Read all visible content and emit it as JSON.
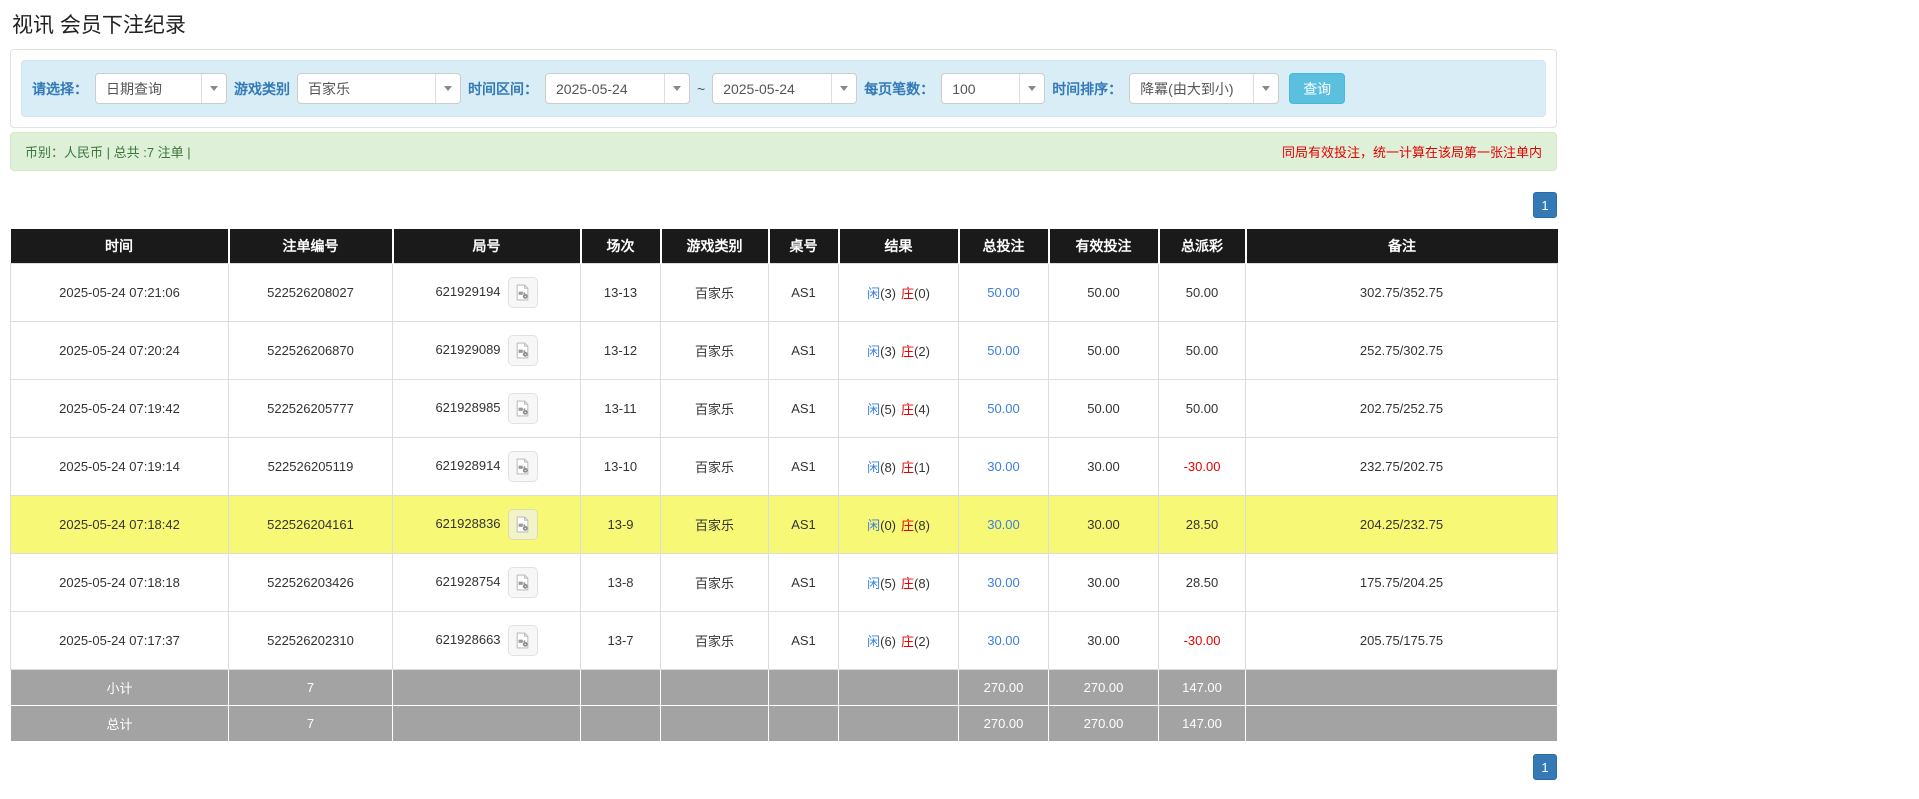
{
  "page": {
    "title": "视讯 会员下注纪录"
  },
  "filter": {
    "select_label": "请选择：",
    "select_value": "日期查询",
    "game_label": "游戏类别",
    "game_value": "百家乐",
    "range_label": "时间区间：",
    "date_from": "2025-05-24",
    "range_sep": "~",
    "date_to": "2025-05-24",
    "pagesize_label": "每页笔数：",
    "pagesize_value": "100",
    "sort_label": "时间排序：",
    "sort_value": "降冪(由大到小)",
    "search_label": "查询"
  },
  "summary": {
    "currency_info": "币别：人民币 | 总共 :7 注单 |",
    "note": "同局有效投注，统一计算在该局第一张注单内"
  },
  "pagination": {
    "page": "1"
  },
  "icons": {
    "row_action": "video-replay-icon",
    "dropdown": "chevron-down-icon"
  },
  "colors": {
    "label_blue": "#337ab7",
    "link_blue": "#3a7fe0",
    "negative_red": "#e60000",
    "highlight_yellow": "#f8f877",
    "header_bg": "#1a1a1a",
    "footer_gray": "#a3a3a3",
    "info_green": "#3c763d",
    "search_button_bg": "#5bc0de",
    "filter_bar_bg": "#d9edf7",
    "summary_bar_bg": "#dff0d8"
  },
  "table": {
    "headers": [
      "时间",
      "注单编号",
      "局号",
      "场次",
      "游戏类别",
      "桌号",
      "结果",
      "总投注",
      "有效投注",
      "总派彩",
      "备注"
    ],
    "rows": [
      {
        "time": "2025-05-24 07:21:06",
        "bet_no": "522526208027",
        "round_no": "621929194",
        "session": "13-13",
        "game": "百家乐",
        "table_no": "AS1",
        "player_label": "闲",
        "player_count": "(3)",
        "banker_label": "庄",
        "banker_count": "(0)",
        "total_bet": "50.00",
        "valid_bet": "50.00",
        "payout": "50.00",
        "payout_neg": false,
        "remark": "302.75/352.75",
        "highlight": false
      },
      {
        "time": "2025-05-24 07:20:24",
        "bet_no": "522526206870",
        "round_no": "621929089",
        "session": "13-12",
        "game": "百家乐",
        "table_no": "AS1",
        "player_label": "闲",
        "player_count": "(3)",
        "banker_label": "庄",
        "banker_count": "(2)",
        "total_bet": "50.00",
        "valid_bet": "50.00",
        "payout": "50.00",
        "payout_neg": false,
        "remark": "252.75/302.75",
        "highlight": false
      },
      {
        "time": "2025-05-24 07:19:42",
        "bet_no": "522526205777",
        "round_no": "621928985",
        "session": "13-11",
        "game": "百家乐",
        "table_no": "AS1",
        "player_label": "闲",
        "player_count": "(5)",
        "banker_label": "庄",
        "banker_count": "(4)",
        "total_bet": "50.00",
        "valid_bet": "50.00",
        "payout": "50.00",
        "payout_neg": false,
        "remark": "202.75/252.75",
        "highlight": false
      },
      {
        "time": "2025-05-24 07:19:14",
        "bet_no": "522526205119",
        "round_no": "621928914",
        "session": "13-10",
        "game": "百家乐",
        "table_no": "AS1",
        "player_label": "闲",
        "player_count": "(8)",
        "banker_label": "庄",
        "banker_count": "(1)",
        "total_bet": "30.00",
        "valid_bet": "30.00",
        "payout": "-30.00",
        "payout_neg": true,
        "remark": "232.75/202.75",
        "highlight": false
      },
      {
        "time": "2025-05-24 07:18:42",
        "bet_no": "522526204161",
        "round_no": "621928836",
        "session": "13-9",
        "game": "百家乐",
        "table_no": "AS1",
        "player_label": "闲",
        "player_count": "(0)",
        "banker_label": "庄",
        "banker_count": "(8)",
        "total_bet": "30.00",
        "valid_bet": "30.00",
        "payout": "28.50",
        "payout_neg": false,
        "remark": "204.25/232.75",
        "highlight": true
      },
      {
        "time": "2025-05-24 07:18:18",
        "bet_no": "522526203426",
        "round_no": "621928754",
        "session": "13-8",
        "game": "百家乐",
        "table_no": "AS1",
        "player_label": "闲",
        "player_count": "(5)",
        "banker_label": "庄",
        "banker_count": "(8)",
        "total_bet": "30.00",
        "valid_bet": "30.00",
        "payout": "28.50",
        "payout_neg": false,
        "remark": "175.75/204.25",
        "highlight": false
      },
      {
        "time": "2025-05-24 07:17:37",
        "bet_no": "522526202310",
        "round_no": "621928663",
        "session": "13-7",
        "game": "百家乐",
        "table_no": "AS1",
        "player_label": "闲",
        "player_count": "(6)",
        "banker_label": "庄",
        "banker_count": "(2)",
        "total_bet": "30.00",
        "valid_bet": "30.00",
        "payout": "-30.00",
        "payout_neg": true,
        "remark": "205.75/175.75",
        "highlight": false
      }
    ],
    "footer": [
      {
        "label": "小计",
        "count": "7",
        "total_bet": "270.00",
        "valid_bet": "270.00",
        "payout": "147.00"
      },
      {
        "label": "总计",
        "count": "7",
        "total_bet": "270.00",
        "valid_bet": "270.00",
        "payout": "147.00"
      }
    ]
  }
}
